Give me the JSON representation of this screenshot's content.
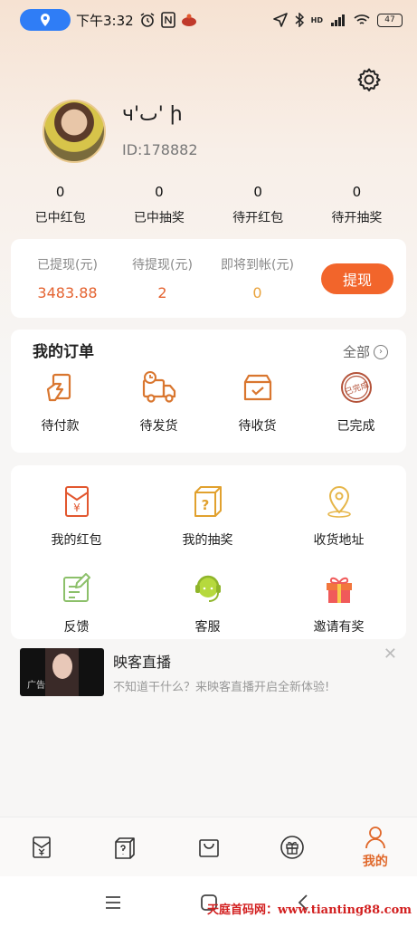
{
  "status_bar": {
    "time": "下午3:32",
    "signal": "HD",
    "battery": "47"
  },
  "profile": {
    "username": "ч'ٮ' ի",
    "user_id": "ID:178882"
  },
  "stats": [
    {
      "value": "0",
      "label": "已中红包"
    },
    {
      "value": "0",
      "label": "已中抽奖"
    },
    {
      "value": "0",
      "label": "待开红包"
    },
    {
      "value": "0",
      "label": "待开抽奖"
    }
  ],
  "wallet": {
    "items": [
      {
        "label": "已提现(元)",
        "value": "3483.88",
        "color": "#e4622f"
      },
      {
        "label": "待提现(元)",
        "value": "2",
        "color": "#e4622f"
      },
      {
        "label": "即将到帐(元)",
        "value": "0",
        "color": "#e9a23b"
      }
    ],
    "withdraw_label": "提现"
  },
  "orders": {
    "title": "我的订单",
    "all_label": "全部",
    "items": [
      {
        "label": "待付款",
        "icon": "wallet-card-icon"
      },
      {
        "label": "待发货",
        "icon": "delivery-truck-icon"
      },
      {
        "label": "待收货",
        "icon": "package-box-icon"
      },
      {
        "label": "已完成",
        "icon": "completed-stamp-icon",
        "stamp_text": "已完成"
      }
    ]
  },
  "services": [
    {
      "label": "我的红包",
      "icon": "red-envelope-icon",
      "symbol": "¥"
    },
    {
      "label": "我的抽奖",
      "icon": "mystery-box-icon",
      "symbol": "?"
    },
    {
      "label": "收货地址",
      "icon": "location-pin-icon"
    },
    {
      "label": "反馈",
      "icon": "feedback-icon"
    },
    {
      "label": "客服",
      "icon": "customer-service-icon"
    },
    {
      "label": "邀请有奖",
      "icon": "gift-icon"
    }
  ],
  "ad": {
    "tag": "广告",
    "title": "映客直播",
    "description": "不知道干什么？来映客直播开启全新体验!"
  },
  "tabbar": {
    "active_label": "我的",
    "tabs": [
      "red-envelope-tab-icon",
      "mystery-box-tab-icon",
      "bag-tab-icon",
      "gift-tab-icon",
      "profile-tab-icon"
    ]
  },
  "watermark": "天庭首码网：www.tianting88.com",
  "colors": {
    "accent": "#f2652b",
    "gold": "#e9a23b",
    "icon_orange": "#e0682a"
  }
}
